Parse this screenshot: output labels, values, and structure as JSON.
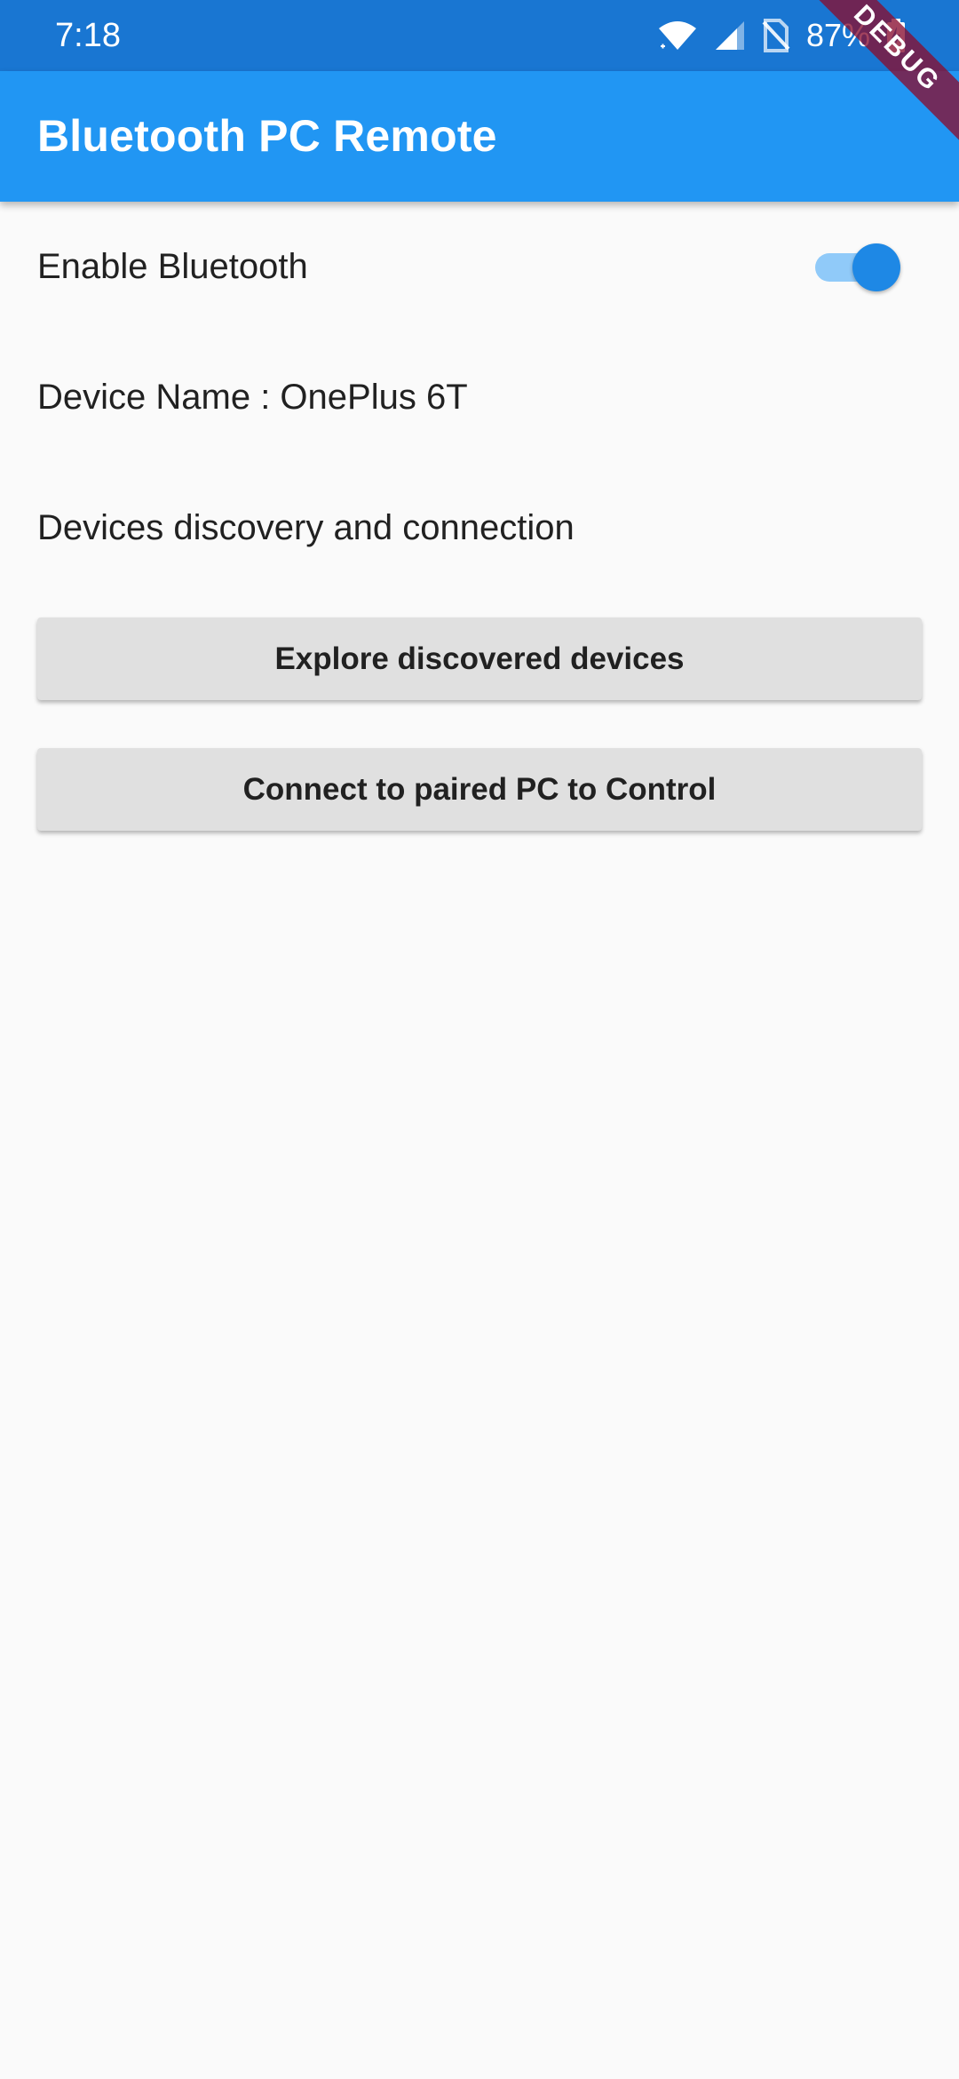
{
  "status_bar": {
    "time": "7:18",
    "battery": "87%",
    "icons": [
      "wifi-icon",
      "signal-icon",
      "no-sim-icon",
      "battery-charging-icon"
    ],
    "background": "#1976d2"
  },
  "app_bar": {
    "title": "Bluetooth PC Remote",
    "background": "#2196f3"
  },
  "debug_banner": "DEBUG",
  "settings": {
    "enable_bluetooth_label": "Enable Bluetooth",
    "bluetooth_enabled": true,
    "device_name_label": "Device Name : OnePlus 6T",
    "discovery_section_label": "Devices discovery and connection"
  },
  "buttons": {
    "explore": "Explore discovered devices",
    "connect": "Connect to paired PC to Control"
  },
  "colors": {
    "accent": "#1e88e5",
    "switch_track": "#90caf9",
    "button_bg": "#e0e0e0",
    "page_bg": "#fafafa"
  }
}
